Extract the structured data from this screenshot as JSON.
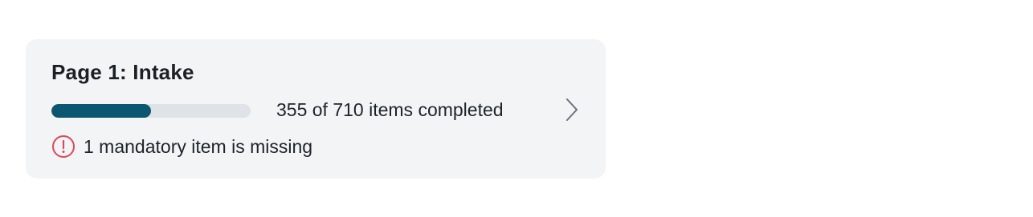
{
  "card": {
    "title": "Page 1: Intake",
    "progress": {
      "completed": 355,
      "total": 710,
      "fraction": 0.5,
      "label": "355 of 710 items completed"
    },
    "warning": {
      "icon": "exclamation-circle-icon",
      "text": "1 mandatory item is missing"
    },
    "chevron_icon": "chevron-right-icon"
  },
  "colors": {
    "card_background": "#f3f4f6",
    "progress_fill": "#0b5772",
    "progress_track": "#dfe3e7",
    "warning": "#e0475a",
    "chevron": "#6b7280"
  }
}
